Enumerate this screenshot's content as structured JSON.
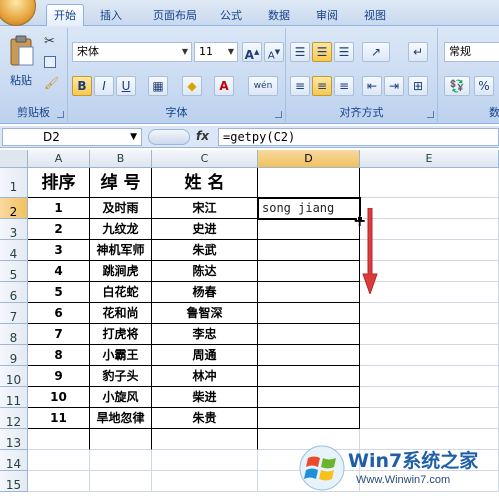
{
  "tabs": [
    "开始",
    "插入",
    "页面布局",
    "公式",
    "数据",
    "审阅",
    "视图"
  ],
  "ribbon": {
    "clipboard": {
      "paste": "粘贴",
      "label": "剪贴板"
    },
    "font": {
      "family": "宋体",
      "size": "11",
      "grow": "A",
      "shrink": "A",
      "bold": "B",
      "italic": "I",
      "underline": "U",
      "label": "字体",
      "phonetic": "wén"
    },
    "alignment": {
      "label": "对齐方式"
    },
    "number": {
      "format": "常规",
      "label": "数"
    }
  },
  "formula_bar": {
    "name_box": "D2",
    "fx": "fx",
    "formula": "=getpy(C2)"
  },
  "columns": [
    "A",
    "B",
    "C",
    "D",
    "E"
  ],
  "rows": [
    "1",
    "2",
    "3",
    "4",
    "5",
    "6",
    "7",
    "8",
    "9",
    "10",
    "11",
    "12",
    "13",
    "14",
    "15"
  ],
  "table": {
    "header": [
      "排序",
      "绰 号",
      "姓 名"
    ],
    "rows": [
      [
        "1",
        "及时雨",
        "宋江"
      ],
      [
        "2",
        "九纹龙",
        "史进"
      ],
      [
        "3",
        "神机军师",
        "朱武"
      ],
      [
        "4",
        "跳涧虎",
        "陈达"
      ],
      [
        "5",
        "白花蛇",
        "杨春"
      ],
      [
        "6",
        "花和尚",
        "鲁智深"
      ],
      [
        "7",
        "打虎将",
        "李忠"
      ],
      [
        "8",
        "小霸王",
        "周通"
      ],
      [
        "9",
        "豹子头",
        "林冲"
      ],
      [
        "10",
        "小旋风",
        "柴进"
      ],
      [
        "11",
        "旱地忽律",
        "朱贵"
      ]
    ]
  },
  "d2_value": "song jiang",
  "watermark": {
    "brand": "Win7系统之家",
    "url": "Www.Winwin7.com"
  },
  "colors": {
    "accent": "#dc3b3b",
    "selected_header": "#f1c15f",
    "ribbon": "#c7d9f1"
  }
}
